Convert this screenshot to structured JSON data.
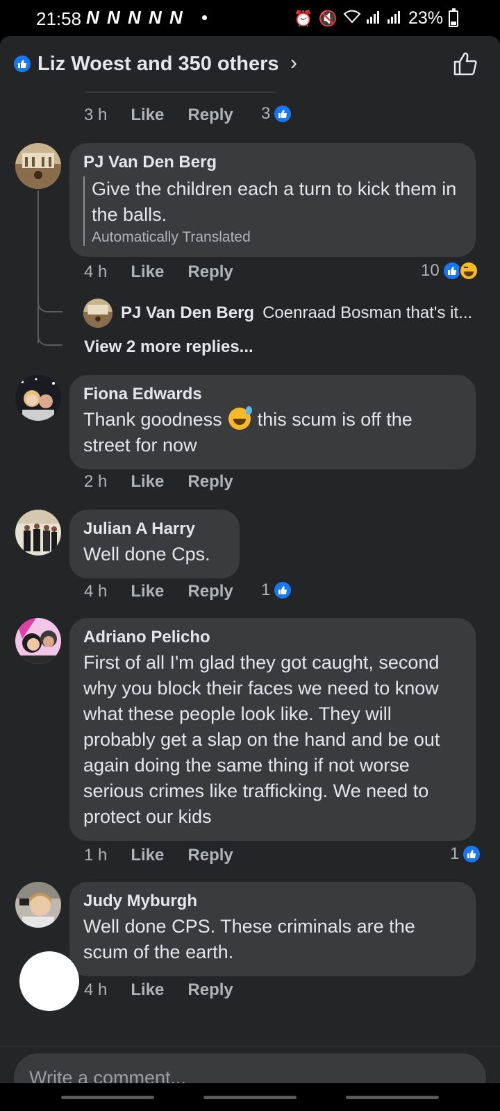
{
  "status_bar": {
    "time": "21:58",
    "notifications": "N N N N N",
    "dot": "•",
    "battery": "23%",
    "battery_level": 0.23
  },
  "header": {
    "reactions_text": "Liz Woest and 350 others",
    "chevron": "›",
    "like_icon": "thumbs-up-outline-icon"
  },
  "comments": [
    {
      "actions": {
        "time": "3 h",
        "like": "Like",
        "reply": "Reply"
      },
      "reaction_count": "3"
    },
    {
      "author": "PJ Van Den Berg",
      "text": "Give the children each a turn to kick them in the balls.",
      "translated_label": "Automatically Translated",
      "actions": {
        "time": "4 h",
        "like": "Like",
        "reply": "Reply"
      },
      "reaction_count": "10",
      "reply_preview": {
        "author": "PJ Van Den Berg",
        "snippet": "Coenraad Bosman that's it..."
      },
      "view_more": "View 2 more replies..."
    },
    {
      "author": "Fiona Edwards",
      "text_before": "Thank goodness",
      "text_after": "this scum is off the street for now",
      "actions": {
        "time": "2 h",
        "like": "Like",
        "reply": "Reply"
      }
    },
    {
      "author": "Julian A Harry",
      "text": "Well done Cps.",
      "actions": {
        "time": "4 h",
        "like": "Like",
        "reply": "Reply"
      },
      "reaction_count": "1"
    },
    {
      "author": "Adriano Pelicho",
      "text": "First of all I'm glad they got caught, second why you block their faces we need to know what these people look like. They will probably get a slap on the hand and be out again doing the same thing if not worse serious crimes like trafficking. We need to protect our kids",
      "actions": {
        "time": "1 h",
        "like": "Like",
        "reply": "Reply"
      },
      "reaction_count": "1"
    },
    {
      "author": "Judy Myburgh",
      "text": "Well done CPS. These criminals are the scum of the earth.",
      "actions": {
        "time": "4 h",
        "like": "Like",
        "reply": "Reply"
      }
    }
  ],
  "composer": {
    "placeholder": "Write a comment..."
  },
  "colors": {
    "panel_bg": "#242526",
    "bubble_bg": "#3a3b3c",
    "like_blue": "#1877f2",
    "text_primary": "#e4e6eb",
    "text_secondary": "#b0b3b8"
  }
}
